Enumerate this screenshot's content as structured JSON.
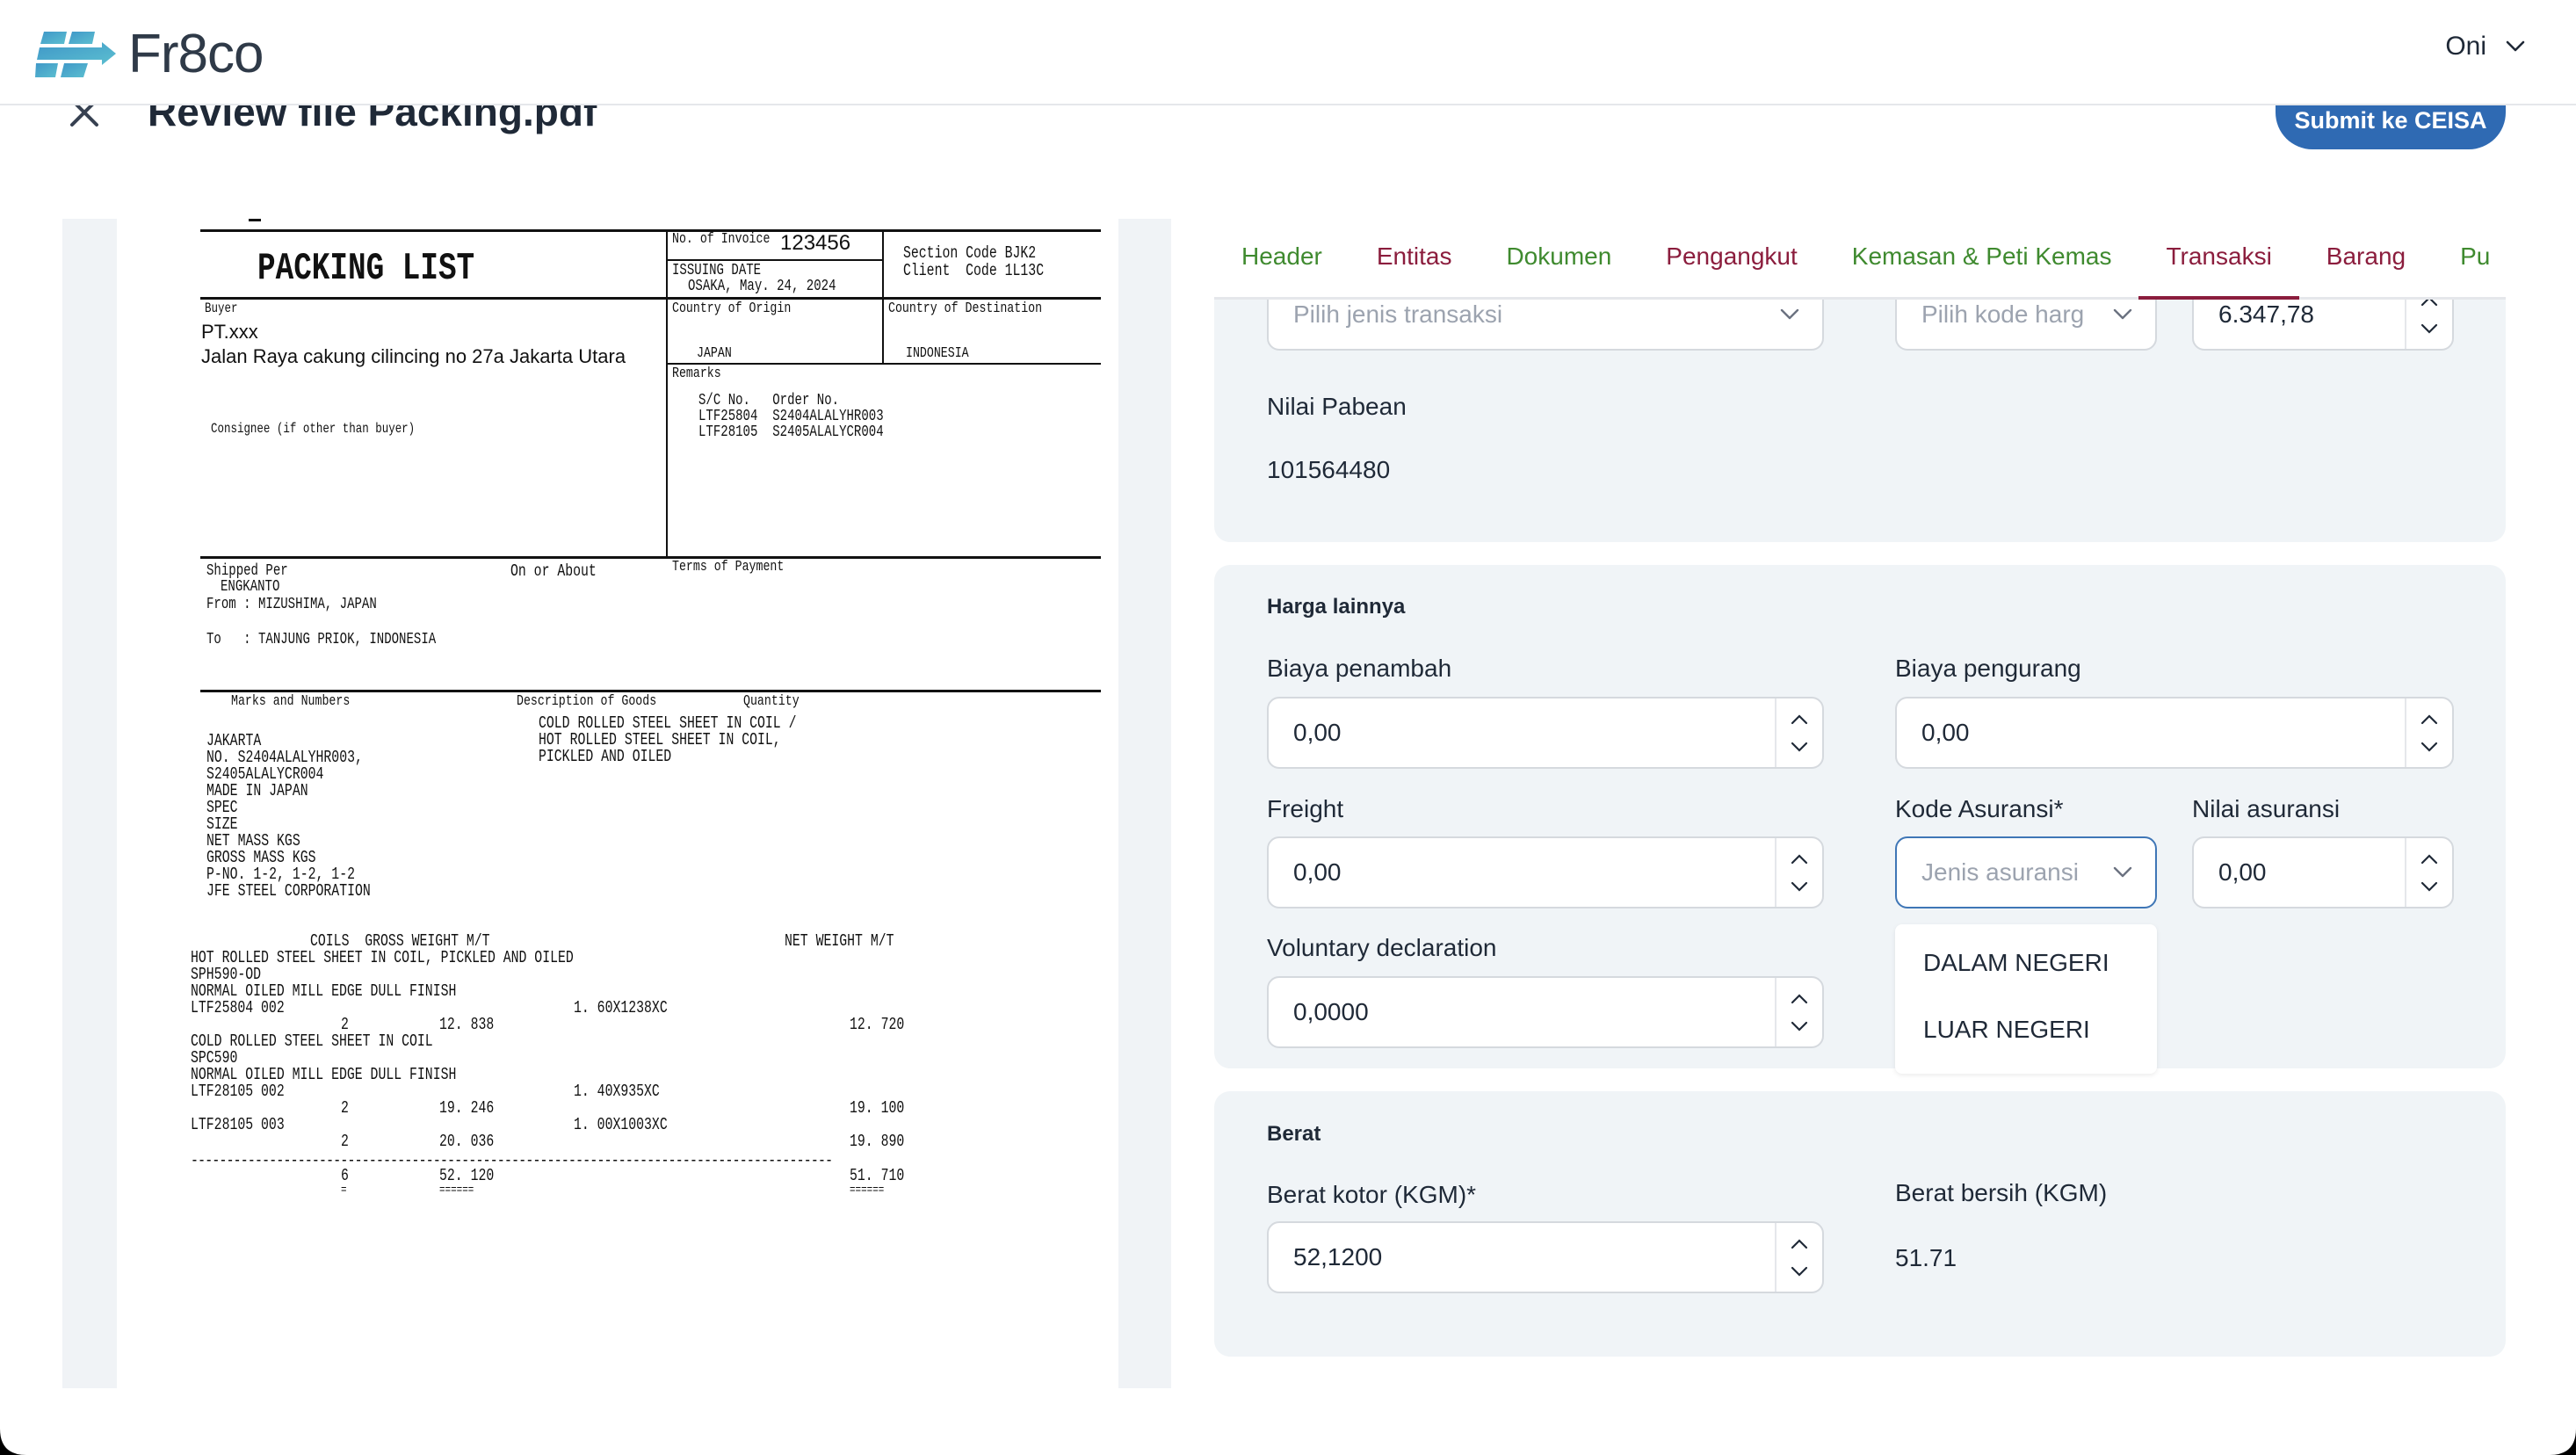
{
  "app": {
    "brand": "Fr8co",
    "user": "Oni"
  },
  "page": {
    "title": "Review file Packing.pdf",
    "submit_label": "Submit ke CEISA"
  },
  "tabs": [
    {
      "label": "Header",
      "status": "green"
    },
    {
      "label": "Entitas",
      "status": "red"
    },
    {
      "label": "Dokumen",
      "status": "green"
    },
    {
      "label": "Pengangkut",
      "status": "red"
    },
    {
      "label": "Kemasan & Peti Kemas",
      "status": "green"
    },
    {
      "label": "Transaksi",
      "status": "red",
      "active": true
    },
    {
      "label": "Barang",
      "status": "red"
    },
    {
      "label": "Pu",
      "status": "green"
    }
  ],
  "transaksi": {
    "jenis_transaksi_placeholder": "Pilih jenis transaksi",
    "kode_harga_placeholder": "Pilih kode harg",
    "ndpbm_value": "6.347,78",
    "nilai_pabean_label": "Nilai Pabean",
    "nilai_pabean_value": "101564480"
  },
  "harga_lainnya": {
    "title": "Harga lainnya",
    "biaya_penambah_label": "Biaya penambah",
    "biaya_penambah_value": "0,00",
    "biaya_pengurang_label": "Biaya pengurang",
    "biaya_pengurang_value": "0,00",
    "freight_label": "Freight",
    "freight_value": "0,00",
    "kode_asuransi_label": "Kode Asuransi*",
    "kode_asuransi_placeholder": "Jenis asuransi",
    "kode_asuransi_options": [
      "DALAM NEGERI",
      "LUAR NEGERI"
    ],
    "nilai_asuransi_label": "Nilai asuransi",
    "nilai_asuransi_value": "0,00",
    "voluntary_label": "Voluntary declaration",
    "voluntary_value": "0,0000"
  },
  "berat": {
    "title": "Berat",
    "kotor_label": "Berat kotor (KGM)*",
    "kotor_value": "52,1200",
    "bersih_label": "Berat bersih (KGM)",
    "bersih_value": "51.71"
  },
  "document": {
    "title": "PACKING LIST",
    "invoice_label": "No. of Invoice",
    "invoice_no": "123456",
    "section_code": "Section Code BJK2",
    "client_code": "Client  Code 1L13C",
    "issuing_date_label": "ISSUING DATE",
    "issuing_date": "OSAKA, May. 24, 2024",
    "buyer_label": "Buyer",
    "buyer_name": "PT.xxx",
    "buyer_address": "Jalan Raya cakung cilincing no 27a Jakarta Utara",
    "consignee_label": "Consignee (if other than buyer)",
    "origin_label": "Country of Origin",
    "origin": "JAPAN",
    "destination_label": "Country of Destination",
    "destination": "INDONESIA",
    "remarks_label": "Remarks",
    "remarks_header": "S/C No.   Order No.",
    "remarks_rows": [
      "LTF25804  S2404ALALYHR003",
      "LTF28105  S2405ALALYCR004"
    ],
    "shipped_per_label": "Shipped Per",
    "vessel": "ENGKANTO",
    "from": "From : MIZUSHIMA, JAPAN",
    "to": "To   : TANJUNG PRIOK, INDONESIA",
    "on_or_about_label": "On or About",
    "terms_label": "Terms of Payment",
    "marks_label": "Marks and Numbers",
    "desc_label": "Description of Goods",
    "qty_label": "Quantity",
    "description_lines": [
      "COLD ROLLED STEEL SHEET IN COIL /",
      "HOT ROLLED STEEL SHEET IN COIL,",
      "PICKLED AND OILED"
    ],
    "marks_lines": [
      "JAKARTA",
      "NO. S2404ALALYHR003,",
      "S2405ALALYCR004",
      "MADE IN JAPAN",
      "SPEC",
      "SIZE",
      "NET MASS KGS",
      "GROSS MASS KGS",
      "P-NO. 1-2, 1-2, 1-2",
      "JFE STEEL CORPORATION"
    ],
    "table_header_left": "COILS  GROSS WEIGHT M/T",
    "table_header_right": "NET WEIGHT M/T",
    "item1_desc": "HOT ROLLED STEEL SHEET IN COIL, PICKLED AND OILED",
    "item1_spec": "SPH590-OD",
    "item1_finish": "NORMAL OILED MILL EDGE DULL FINISH",
    "item1_lot": "LTF25804 002",
    "item1_size": "1. 60X1238XC",
    "item1_coils": "2",
    "item1_gross": "12. 838",
    "item1_net": "12. 720",
    "item2_desc": "COLD ROLLED STEEL SHEET IN COIL",
    "item2_spec": "SPC590",
    "item2_finish": "NORMAL OILED MILL EDGE DULL FINISH",
    "item2_lot": "LTF28105 002",
    "item2_size": "1. 40X935XC",
    "item2_coils": "2",
    "item2_gross": "19. 246",
    "item2_net": "19. 100",
    "item3_lot": "LTF28105 003",
    "item3_size": "1. 00X1003XC",
    "item3_coils": "2",
    "item3_gross": "20. 036",
    "item3_net": "19. 890",
    "total_coils": "6",
    "total_gross": "52. 120",
    "total_net": "51. 710",
    "dashes": "------------------------------------------------------------------------------------------",
    "eq_short": "=",
    "eq_long": "======"
  },
  "colors": {
    "brand_blue": "#2f6ab3",
    "tab_ok": "#3f8a2f",
    "tab_error": "#8b1d3d",
    "card_bg": "#f0f4f7"
  },
  "icons": {
    "close": "close-icon",
    "chevron": "chevron-down-icon",
    "spinner_up": "chevron-up-icon",
    "spinner_down": "chevron-down-icon",
    "logo": "fr8co-logo-icon"
  }
}
